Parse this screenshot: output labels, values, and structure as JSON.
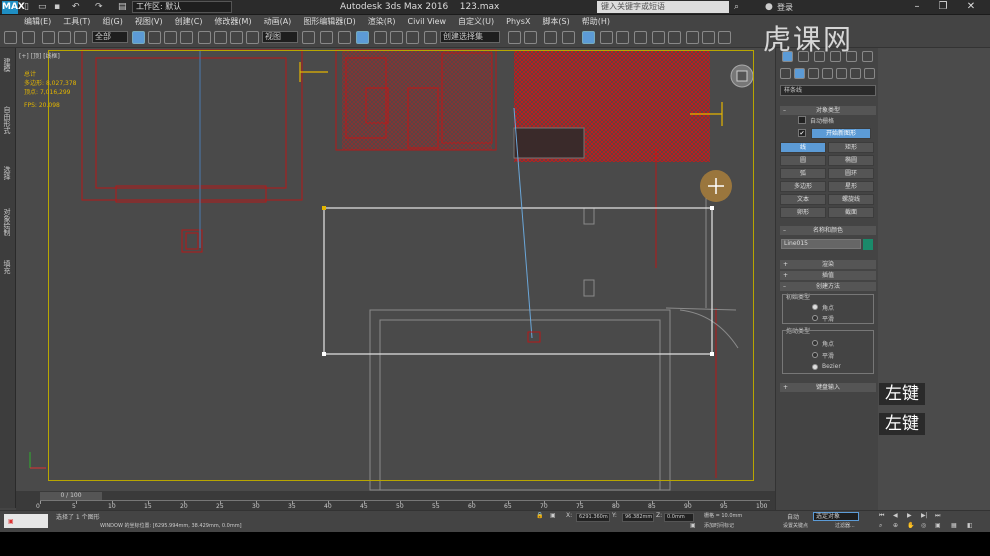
{
  "titlebar": {
    "app_icon": "MAX",
    "workspace": "工作区: 默认",
    "title": "Autodesk 3ds Max 2016",
    "file": "123.max",
    "search_placeholder": "键入关键字或短语",
    "login": "登录"
  },
  "menu": [
    "编辑(E)",
    "工具(T)",
    "组(G)",
    "视图(V)",
    "创建(C)",
    "修改器(M)",
    "动画(A)",
    "图形编辑器(D)",
    "渲染(R)",
    "Civil View",
    "自定义(U)",
    "PhysX",
    "脚本(S)",
    "帮助(H)"
  ],
  "toolbar": {
    "select_filter": "全部",
    "ref_coord": "视图",
    "named_selection": "创建选择集"
  },
  "left_strip": [
    "建模",
    "自由形式",
    "选择",
    "对象绘制",
    "填充"
  ],
  "viewport": {
    "label": "[+] [顶] [线框]",
    "stats": {
      "total_label": "总计",
      "poly_label": "多边形:",
      "poly_value": "8,027,378",
      "vert_label": "顶点:",
      "vert_value": "7,016,299",
      "fps_label": "FPS:",
      "fps_value": "20.098"
    }
  },
  "timeline": {
    "slider": "0 / 100",
    "ticks": [
      "0",
      "5",
      "10",
      "15",
      "20",
      "25",
      "30",
      "35",
      "40",
      "45",
      "50",
      "55",
      "60",
      "65",
      "70",
      "75",
      "80",
      "85",
      "90",
      "95",
      "100"
    ]
  },
  "status": {
    "selection": "选择了 1 个图形",
    "prompt": "WINDOW 的坐标位置: [6295.994mm, 38.429mm, 0.0mm]",
    "x": "6291.360m",
    "y": "96.382mm",
    "z": "0.0mm",
    "grid": "栅格 = 10.0mm",
    "add_tag": "添加时间标记"
  },
  "panel": {
    "category": "样条线",
    "object_type_header": "对象类型",
    "auto_grid": "自动栅格",
    "start_new_shape": "开始新图形",
    "buttons": [
      "线",
      "矩形",
      "圆",
      "椭圆",
      "弧",
      "圆环",
      "多边形",
      "星形",
      "文本",
      "螺旋线",
      "卵形",
      "截面"
    ],
    "name_color_header": "名称和颜色",
    "name_value": "Line015",
    "render_header": "渲染",
    "interp_header": "插值",
    "create_method_header": "创建方法",
    "initial_type_label": "初始类型",
    "initial_opts": [
      "角点",
      "平滑"
    ],
    "drag_type_label": "拖动类型",
    "drag_opts": [
      "角点",
      "平滑",
      "Bezier"
    ],
    "keyboard_header": "键盘输入"
  },
  "watermark": "虎课网",
  "hints": [
    "左键",
    "左键"
  ],
  "anim": {
    "auto": "自动",
    "sel_obj": "选定对象",
    "set_key": "设置关键点",
    "filters": "过滤器..."
  },
  "colors": {
    "accent": "#5c9bd6",
    "frame": "#b8a600",
    "geometry": "#c31a1a",
    "swatch": "#1a8a6a"
  }
}
